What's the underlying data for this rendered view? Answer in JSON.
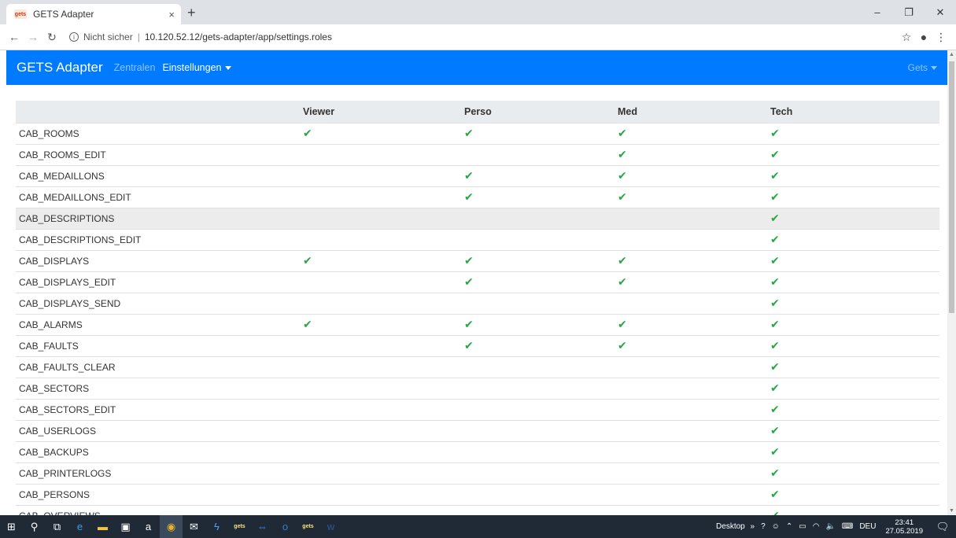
{
  "browser": {
    "tab_title": "GETS Adapter",
    "tab_close": "×",
    "new_tab": "+",
    "favicon_text": "gets",
    "security_label": "Nicht sicher",
    "separator": "|",
    "url": "10.120.52.12/gets-adapter/app/settings.roles",
    "window_minimize": "–",
    "window_maximize": "❐",
    "window_close": "✕"
  },
  "navbar": {
    "brand": "GETS Adapter",
    "links": [
      "Zentralen",
      "Einstellungen"
    ],
    "user": "Gets"
  },
  "table": {
    "columns": [
      "",
      "Viewer",
      "Perso",
      "Med",
      "Tech"
    ],
    "check_glyph": "✔",
    "rows": [
      {
        "name": "CAB_ROOMS",
        "viewer": true,
        "perso": true,
        "med": true,
        "tech": true
      },
      {
        "name": "CAB_ROOMS_EDIT",
        "viewer": false,
        "perso": false,
        "med": true,
        "tech": true
      },
      {
        "name": "CAB_MEDAILLONS",
        "viewer": false,
        "perso": true,
        "med": true,
        "tech": true
      },
      {
        "name": "CAB_MEDAILLONS_EDIT",
        "viewer": false,
        "perso": true,
        "med": true,
        "tech": true
      },
      {
        "name": "CAB_DESCRIPTIONS",
        "viewer": false,
        "perso": false,
        "med": false,
        "tech": true,
        "highlighted": true
      },
      {
        "name": "CAB_DESCRIPTIONS_EDIT",
        "viewer": false,
        "perso": false,
        "med": false,
        "tech": true
      },
      {
        "name": "CAB_DISPLAYS",
        "viewer": true,
        "perso": true,
        "med": true,
        "tech": true
      },
      {
        "name": "CAB_DISPLAYS_EDIT",
        "viewer": false,
        "perso": true,
        "med": true,
        "tech": true
      },
      {
        "name": "CAB_DISPLAYS_SEND",
        "viewer": false,
        "perso": false,
        "med": false,
        "tech": true
      },
      {
        "name": "CAB_ALARMS",
        "viewer": true,
        "perso": true,
        "med": true,
        "tech": true
      },
      {
        "name": "CAB_FAULTS",
        "viewer": false,
        "perso": true,
        "med": true,
        "tech": true
      },
      {
        "name": "CAB_FAULTS_CLEAR",
        "viewer": false,
        "perso": false,
        "med": false,
        "tech": true
      },
      {
        "name": "CAB_SECTORS",
        "viewer": false,
        "perso": false,
        "med": false,
        "tech": true
      },
      {
        "name": "CAB_SECTORS_EDIT",
        "viewer": false,
        "perso": false,
        "med": false,
        "tech": true
      },
      {
        "name": "CAB_USERLOGS",
        "viewer": false,
        "perso": false,
        "med": false,
        "tech": true
      },
      {
        "name": "CAB_BACKUPS",
        "viewer": false,
        "perso": false,
        "med": false,
        "tech": true
      },
      {
        "name": "CAB_PRINTERLOGS",
        "viewer": false,
        "perso": false,
        "med": false,
        "tech": true
      },
      {
        "name": "CAB_PERSONS",
        "viewer": false,
        "perso": false,
        "med": false,
        "tech": true
      },
      {
        "name": "CAB_OVERVIEWS",
        "viewer": false,
        "perso": false,
        "med": false,
        "tech": true
      }
    ]
  },
  "taskbar": {
    "apps": [
      {
        "icon": "windows-start-icon",
        "glyph": "⊞"
      },
      {
        "icon": "search-icon",
        "glyph": "⚲"
      },
      {
        "icon": "task-view-icon",
        "glyph": "⧉"
      },
      {
        "icon": "edge-icon",
        "glyph": "e",
        "color": "#3aa0e8"
      },
      {
        "icon": "file-explorer-icon",
        "glyph": "▬",
        "color": "#f4c542"
      },
      {
        "icon": "store-icon",
        "glyph": "▣",
        "color": "#ffffff"
      },
      {
        "icon": "amazon-icon",
        "glyph": "a",
        "color": "#ffffff"
      },
      {
        "icon": "chrome-icon",
        "glyph": "◉",
        "color": "#e9b32b",
        "active": true
      },
      {
        "icon": "mail-icon",
        "glyph": "✉",
        "color": "#ffffff"
      },
      {
        "icon": "powershell-icon",
        "glyph": "ϟ",
        "color": "#4aa3ff"
      },
      {
        "icon": "gets-app-icon",
        "glyph": "gets",
        "color": "#ffe27a"
      },
      {
        "icon": "teamviewer-icon",
        "glyph": "⇔",
        "color": "#3c8dfc"
      },
      {
        "icon": "outlook-icon",
        "glyph": "o",
        "color": "#2f7fd1"
      },
      {
        "icon": "gets-app-icon-2",
        "glyph": "gets",
        "color": "#ffe27a"
      },
      {
        "icon": "word-icon",
        "glyph": "w",
        "color": "#2b5797"
      }
    ],
    "desktop_label": "Desktop",
    "language": "DEU",
    "time": "23:41",
    "date": "27.05.2019"
  }
}
